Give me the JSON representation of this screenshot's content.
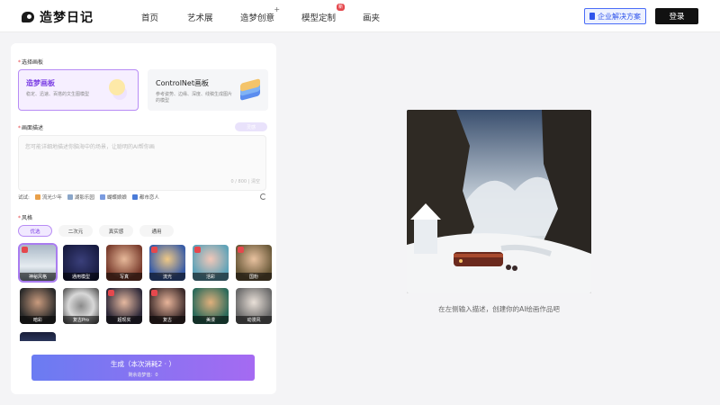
{
  "header": {
    "logo_text": "造梦日记",
    "nav": [
      {
        "label": "首页",
        "sup": "",
        "badge": ""
      },
      {
        "label": "艺术展",
        "sup": "",
        "badge": ""
      },
      {
        "label": "造梦创意",
        "sup": "+",
        "badge": ""
      },
      {
        "label": "模型定制",
        "sup": "",
        "badge": "新"
      },
      {
        "label": "画夹",
        "sup": "",
        "badge": ""
      }
    ],
    "enterprise_label": "企业解决方案",
    "login_label": "登录"
  },
  "panel": {
    "canvas_label": "选择画板",
    "cards": [
      {
        "title": "造梦画板",
        "desc": "稳定、迅速、百搭的文生图模型"
      },
      {
        "title": "ControlNet画板",
        "desc": "参考姿势、边缘、深度、线稿生成图片的模型"
      }
    ],
    "prompt_label": "画面描述",
    "helper_label": "灵感",
    "prompt_placeholder": "您可能详细地描述你脑海中的场景，让聪明的AI帮你画",
    "counter": "0 / 800",
    "clear_label": "清空",
    "try_label": "试试:",
    "try_tags": [
      "流光少年",
      "湖影乐园",
      "蝴蝶娘娘",
      "都市恋人"
    ],
    "style_label": "风格",
    "style_tabs": [
      "优选",
      "二次元",
      "真实感",
      "通用"
    ],
    "styles": [
      {
        "label": "神秘风格"
      },
      {
        "label": "通用模型"
      },
      {
        "label": "写真"
      },
      {
        "label": "流光"
      },
      {
        "label": "活彩"
      },
      {
        "label": "国粉"
      },
      {
        "label": "暗彩"
      },
      {
        "label": "复古Pro"
      },
      {
        "label": "超现实"
      },
      {
        "label": "复古"
      },
      {
        "label": "美漫"
      },
      {
        "label": "动漫风"
      }
    ],
    "generate_label": "生成（本次消耗2 · ）",
    "remaining_label": "剩余造梦值：0"
  },
  "preview": {
    "caption": "在左侧输入描述，创建你的AI绘画作品吧"
  },
  "colors": {
    "accent": "#7b3fe4",
    "brand_dark": "#111111",
    "enterprise_blue": "#2f54eb"
  }
}
